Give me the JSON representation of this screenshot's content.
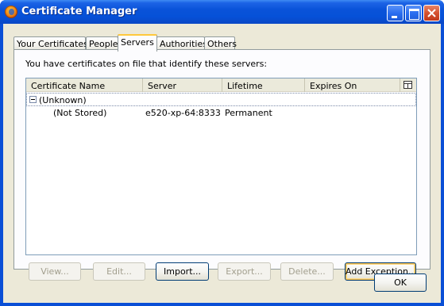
{
  "window": {
    "title": "Certificate Manager"
  },
  "tabs": [
    {
      "label": "Your Certificates",
      "active": false
    },
    {
      "label": "People",
      "active": false
    },
    {
      "label": "Servers",
      "active": true
    },
    {
      "label": "Authorities",
      "active": false
    },
    {
      "label": "Others",
      "active": false
    }
  ],
  "panel": {
    "description": "You have certificates on file that identify these servers:"
  },
  "tree": {
    "columns": [
      "Certificate Name",
      "Server",
      "Lifetime",
      "Expires On"
    ],
    "group": {
      "label": "(Unknown)",
      "expanded": true
    },
    "rows": [
      {
        "name": "(Not Stored)",
        "server": "e520-xp-64:8333",
        "lifetime": "Permanent",
        "expires": ""
      }
    ]
  },
  "buttons": {
    "view": "View...",
    "edit": "Edit...",
    "import": "Import...",
    "export": "Export...",
    "delete": "Delete...",
    "add_exception": "Add Exception..."
  },
  "footer": {
    "ok": "OK"
  },
  "colors": {
    "titlebar": "#0a53d9",
    "dialog_bg": "#ece9d8",
    "active_tab_accent": "#ffc83c"
  }
}
